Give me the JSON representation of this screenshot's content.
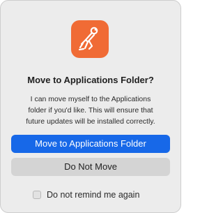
{
  "dialog": {
    "icon": "postman-astronaut-icon",
    "title": "Move to Applications Folder?",
    "message_lines": [
      "I can move myself to the Applications",
      "folder if you'd like. This will ensure that",
      "future updates will be installed correctly."
    ],
    "primary_button_label": "Move to Applications Folder",
    "secondary_button_label": "Do Not Move",
    "remind_checkbox_label": "Do not remind me again",
    "remind_checkbox_checked": false
  },
  "colors": {
    "icon_bg": "#f06b35",
    "primary_button": "#1768e8",
    "secondary_button": "#d4d4d4",
    "dialog_bg": "#ececec"
  }
}
